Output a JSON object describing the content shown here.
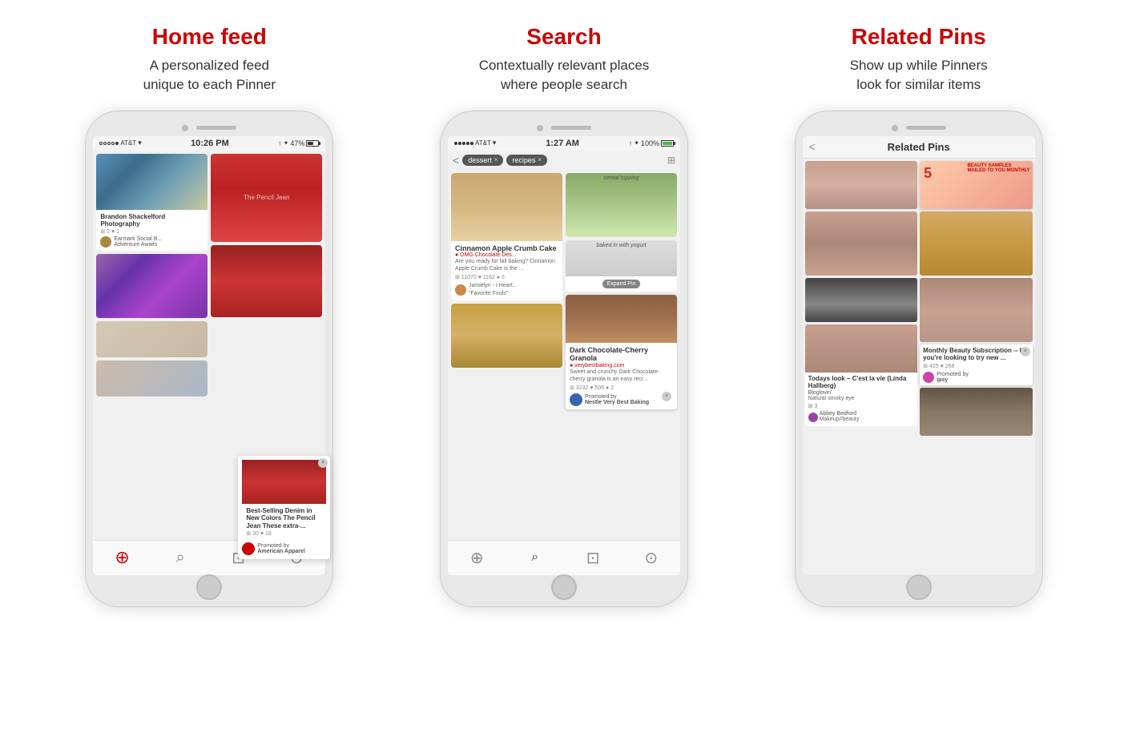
{
  "columns": [
    {
      "id": "home-feed",
      "title": "Home feed",
      "subtitle": "A personalized feed\nunique to each Pinner",
      "status_left": "●●●●○ AT&T ▾",
      "status_center": "10:26 PM",
      "status_right": "↑ ✦ 47%",
      "nav_active": "home",
      "promoted": {
        "title": "Best-Selling Denim in New Colors The Pencil Jean These extra-...",
        "pin_counts": "⊞ 30  ♥ 18",
        "brand": "Promoted by",
        "brand_name": "American Apparel"
      },
      "pins": [
        {
          "title": "Brandon Shackelford Photography",
          "counts": "⊞ 2  ♥ 1",
          "user": "Earmark Social B...",
          "sub": "Adventure Awaits"
        },
        {
          "title": "The Pencil Jean",
          "counts": ""
        },
        {
          "title": "",
          "counts": ""
        }
      ]
    },
    {
      "id": "search",
      "title": "Search",
      "subtitle": "Contextually relevant places\nwhere people search",
      "status_left": "●●●●● AT&T ▾",
      "status_center": "1:27 AM",
      "status_right": "↑ ✦ 100%",
      "nav_active": "search",
      "search_tags": [
        "dessert",
        "recipes"
      ],
      "pins": [
        {
          "title": "Cinnamon Apple Crumb Cake",
          "site": "OMG Chocolate Des...",
          "desc": "Are you ready for fall baking? Cinnamon Apple Crumb Cake is the ...",
          "counts": "⊞ 11070  ♥ 1162  ● 5",
          "user": "Jamielyn - I Heart...",
          "user_sub": "\"Favorite Finds\""
        },
        {
          "title": "Dark Chocolate-Cherry Granola",
          "site": "verybestbaking.com",
          "desc": "Sweet and crunchy Dark Chocolate-cherry granola is an easy reci...",
          "counts": "⊞ 3232  ♥ 506  ● 2",
          "brand": "Promoted by",
          "brand_name": "Nestle Very Best Baking"
        }
      ]
    },
    {
      "id": "related-pins",
      "title": "Related Pins",
      "subtitle": "Show up while Pinners\nlook for similar items",
      "header_title": "Related Pins",
      "pins": [
        {
          "title": "Todays look – C'est la vie (Linda Hallberg)",
          "source": "Bloglovin'",
          "desc": "Natural smoky eye",
          "counts": "⊞ 3",
          "user": "Abbey Bedford",
          "user_sub": "Makeup//beauty"
        },
        {
          "title": "Monthly Beauty Subscription -- If you're looking to try new ...",
          "counts": "⊞ 425  ♥ 268",
          "brand": "Promoted by",
          "brand_name": "ipsy"
        }
      ]
    }
  ]
}
